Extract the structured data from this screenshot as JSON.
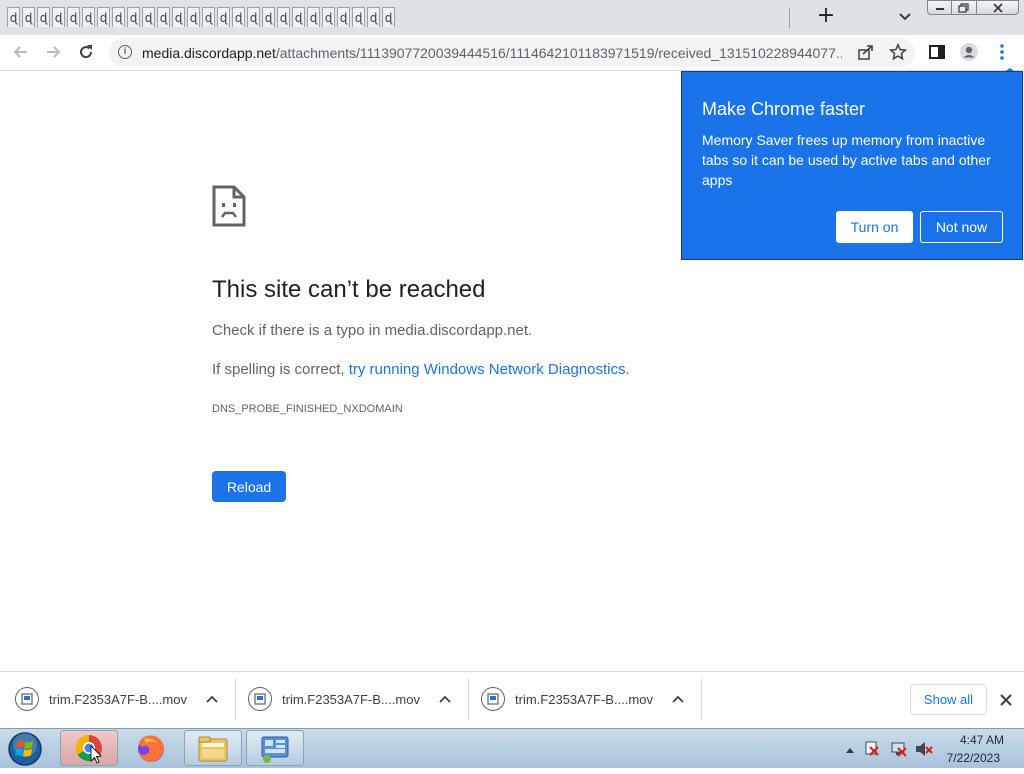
{
  "tabstrip": {
    "tab_glyph": "ɖ",
    "tab_count": 26,
    "new_tab_label": "+"
  },
  "toolbar": {
    "url_host": "media.discordapp.net",
    "url_path": "/attachments/1113907720039444516/1114642101183971519/received_131510228944077..."
  },
  "error_page": {
    "title": "This site can’t be reached",
    "check_prefix": "Check if there is a typo in ",
    "check_host": "media.discordapp.net",
    "check_suffix": ".",
    "spell_prefix": "If spelling is correct, ",
    "spell_link": "try running Windows Network Diagnostics",
    "spell_suffix": ".",
    "error_code": "DNS_PROBE_FINISHED_NXDOMAIN",
    "reload_label": "Reload"
  },
  "bubble": {
    "title": "Make Chrome faster",
    "body": "Memory Saver frees up memory from inactive tabs so it can be used by active tabs and other apps",
    "turn_on_label": "Turn on",
    "not_now_label": "Not now"
  },
  "downloads": {
    "items": [
      {
        "filename": "trim.F2353A7F-B....mov"
      },
      {
        "filename": "trim.F2353A7F-B....mov"
      },
      {
        "filename": "trim.F2353A7F-B....mov"
      }
    ],
    "show_all_label": "Show all"
  },
  "taskbar": {
    "clock_time": "4:47 AM",
    "clock_date": "7/22/2023",
    "apps": [
      "chrome-icon",
      "firefox-icon",
      "file-explorer-icon",
      "control-panel-icon"
    ]
  },
  "colors": {
    "accent": "#1a73e8",
    "tabstrip_bg": "#dee1e6",
    "omnibox_bg": "#f1f3f4"
  }
}
